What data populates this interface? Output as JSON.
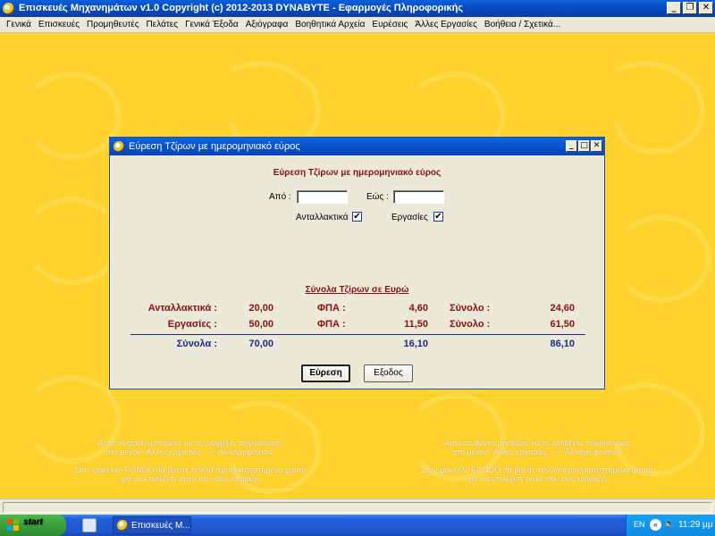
{
  "window": {
    "title": "Επισκευές Μηχανημάτων  v1.0    Copyright (c) 2012-2013  DYNABYTE - Εφαρμογές Πληροφορικής",
    "minimize": "_",
    "restore": "❐",
    "close": "✕"
  },
  "menu": [
    "Γενικά",
    "Επισκευές",
    "Προμηθευτές",
    "Πελάτες",
    "Γενικά Έξοδα",
    "Αξιόγραφα",
    "Βοηθητικά Αρχεία",
    "Ευρέσεις",
    "Άλλες Εργασίες",
    "Βοήθεια / Σχετικά..."
  ],
  "background_notes": {
    "left": {
      "line1": "Αυτό το φόντο μπορείτε να το αλλάξετε πηγαίνοντας",
      "line2": "στο μενού \"Αλλες εργασίες\" -> \"Αλλαγή φόντου\"",
      "line3": "Στον φάκελλο FONDO θα βρείτε πολλά προεγκατεστημένα φόντα",
      "line4": "για να επιλέξετε αυτό που σας ταιριάζει"
    },
    "right": {
      "line1": "Αυτό το φόντο μπορείτε να το αλλάξετε πηγαίνοντας",
      "line2": "στο μενού \"Αλλες εργασίες\" -> \"Αλλαγή φόντου\"",
      "line3": "Στον φάκελλο FONDO θα βρείτε πολλά προεγκατεστημένα φόντα",
      "line4": "για να επιλέξετε αυτό που σας ταιριάζει"
    }
  },
  "dialog": {
    "title": "Εύρεση Τζίρων με ημερομηνιακό εύρος",
    "heading": "Εύρεση Τζίρων με ημερομηνιακό εύρος",
    "from_label": "Από :",
    "from_value": "",
    "to_label": "Εώς :",
    "to_value": "",
    "spare_parts_label": "Ανταλλακτικά",
    "spare_parts_checked": "✔",
    "jobs_label": "Εργασίες",
    "jobs_checked": "✔",
    "summary_title": "Σύνολα Τζίρων σε Ευρώ",
    "rows": [
      {
        "label": "Ανταλλακτικά :",
        "net": "20,00",
        "vat_label": "ΦΠΑ :",
        "vat": "4,60",
        "total_label": "Σύνολο :",
        "total": "24,60"
      },
      {
        "label": "Εργασίες :",
        "net": "50,00",
        "vat_label": "ΦΠΑ :",
        "vat": "11,50",
        "total_label": "Σύνολο :",
        "total": "61,50"
      }
    ],
    "totals": {
      "label": "Σύνολα :",
      "net": "70,00",
      "vat": "16,10",
      "total": "86,10"
    },
    "search_button": "Εύρεση",
    "exit_button": "Εξοδος"
  },
  "taskbar": {
    "start": "start",
    "task_item": "Επισκευές Μ...",
    "language": "EN",
    "chevron": "«",
    "clock": "11:29 μμ"
  },
  "colors": {
    "background": "#ffd22e",
    "accent_red": "#8a1010",
    "accent_blue": "#1a2a8a"
  }
}
